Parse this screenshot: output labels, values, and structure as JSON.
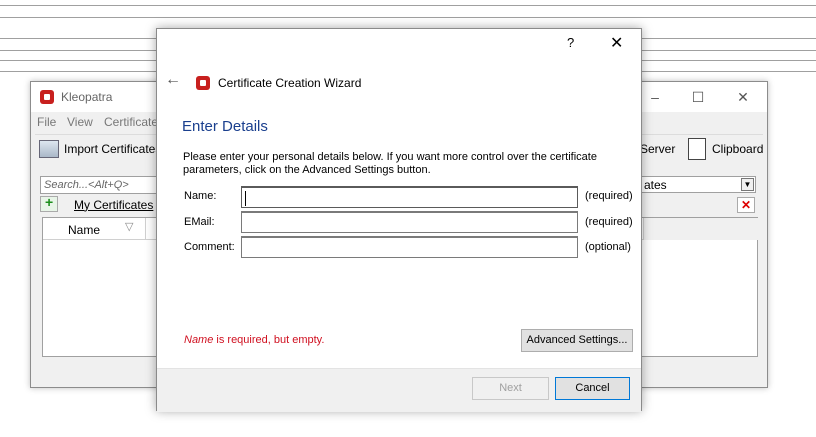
{
  "kleopatra": {
    "title": "Kleopatra",
    "menu": [
      "File",
      "View",
      "Certificate"
    ],
    "toolbar": {
      "import_label": "Import Certificates",
      "server_label": "Server",
      "clipboard_label": "Clipboard"
    },
    "search_placeholder": "Search...<Alt+Q>",
    "tab_label": "My Certificates",
    "tab_label_underlined": "M",
    "tab_label_rest": "y Certificates",
    "column_name": "Name",
    "filter_value": "ates"
  },
  "wizard": {
    "title": "Certificate Creation Wizard",
    "heading": "Enter Details",
    "description": "Please enter your personal details below. If you want more control over the certificate parameters, click on the Advanced Settings button.",
    "fields": [
      {
        "label": "Name:",
        "value": "",
        "hint": "(required)"
      },
      {
        "label": "EMail:",
        "value": "",
        "hint": "(required)"
      },
      {
        "label": "Comment:",
        "value": "",
        "hint": "(optional)"
      }
    ],
    "error_field": "Name",
    "error_text": " is required, but empty.",
    "advanced_label": "Advanced Settings...",
    "next_label": "Next",
    "cancel_label": "Cancel",
    "help_symbol": "?",
    "close_symbol": "✕",
    "back_symbol": "←"
  },
  "colors": {
    "heading": "#1a3f8e",
    "error": "#d01020",
    "app_icon": "#c8201e",
    "focus_border": "#0078d7"
  }
}
